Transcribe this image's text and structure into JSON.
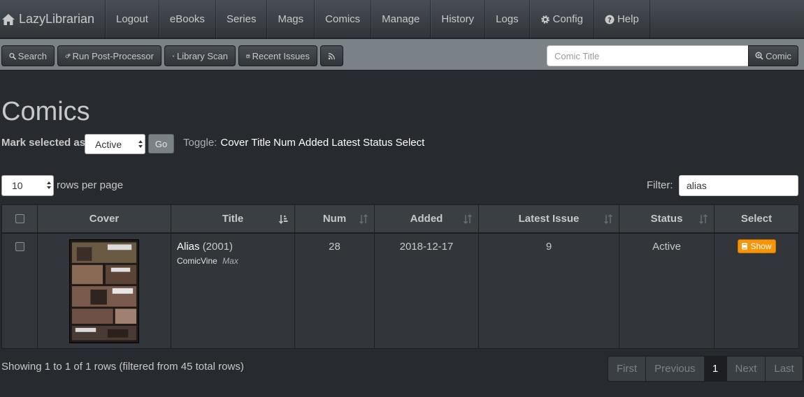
{
  "brand": {
    "name": "LazyLibrarian",
    "icon": "home-icon"
  },
  "nav": {
    "items": [
      {
        "label": "Logout"
      },
      {
        "label": "eBooks"
      },
      {
        "label": "Series"
      },
      {
        "label": "Mags"
      },
      {
        "label": "Comics"
      },
      {
        "label": "Manage"
      },
      {
        "label": "History"
      },
      {
        "label": "Logs"
      },
      {
        "label": "Config",
        "icon": "gear-icon"
      },
      {
        "label": "Help",
        "icon": "question-circle-icon"
      }
    ]
  },
  "toolbar": {
    "search_label": "Search",
    "postprocessor_label": "Run Post-Processor",
    "libscan_label": "Library Scan",
    "recent_label": "Recent Issues",
    "rss_icon": "rss-icon",
    "comic_search_placeholder": "Comic Title",
    "comic_search_button": "Comic"
  },
  "page": {
    "title": "Comics",
    "mark_label": "Mark selected as",
    "mark_value": "Active",
    "go_label": "Go",
    "toggle_label": "Toggle:",
    "toggles": [
      "Cover",
      "Title",
      "Num",
      "Added",
      "Latest",
      "Status",
      "Select"
    ],
    "rows_per_page": "10",
    "rows_label": "rows per page",
    "filter_label": "Filter:",
    "filter_value": "alias"
  },
  "table": {
    "columns": [
      "Cover",
      "Title",
      "Num",
      "Added",
      "Latest Issue",
      "Status",
      "Select"
    ],
    "rows": [
      {
        "title": "Alias",
        "year": "(2001)",
        "source": "ComicVine",
        "publisher": "Max",
        "num": "28",
        "added": "2018-12-17",
        "latest": "9",
        "status": "Active",
        "select_label": "Show"
      }
    ]
  },
  "footer": {
    "showing": "Showing 1 to 1 of 1 rows (filtered from 45 total rows)",
    "pager": [
      "First",
      "Previous",
      "1",
      "Next",
      "Last"
    ]
  },
  "colors": {
    "background": "#272b30",
    "navbar": "#3a3f44",
    "toolbar": "#7a8288",
    "accent_orange": "#f89406"
  }
}
